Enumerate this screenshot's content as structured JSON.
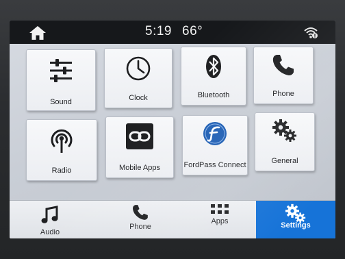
{
  "status_bar": {
    "time": "5:19",
    "temperature": "66°"
  },
  "tiles": [
    {
      "label": "Sound",
      "icon": "sliders-icon"
    },
    {
      "label": "Clock",
      "icon": "clock-icon"
    },
    {
      "label": "Bluetooth",
      "icon": "bluetooth-icon"
    },
    {
      "label": "Phone",
      "icon": "phone-icon"
    },
    {
      "label": "Radio",
      "icon": "radio-antenna-icon"
    },
    {
      "label": "Mobile Apps",
      "icon": "link-icon"
    },
    {
      "label": "FordPass Connect",
      "icon": "fordpass-icon"
    },
    {
      "label": "General",
      "icon": "gears-icon"
    }
  ],
  "pagination": {
    "active_color": "#1e6fd0",
    "inactive_color": "#5a5e66"
  },
  "bottom_nav": [
    {
      "label": "Audio",
      "icon": "music-note-icon"
    },
    {
      "label": "Phone",
      "icon": "phone-icon"
    },
    {
      "label": "Apps",
      "icon": "apps-grid-icon"
    },
    {
      "label": "Settings",
      "icon": "gears-icon",
      "active": true
    }
  ],
  "colors": {
    "accent": "#1673d8",
    "status_bar": "#16181b"
  }
}
